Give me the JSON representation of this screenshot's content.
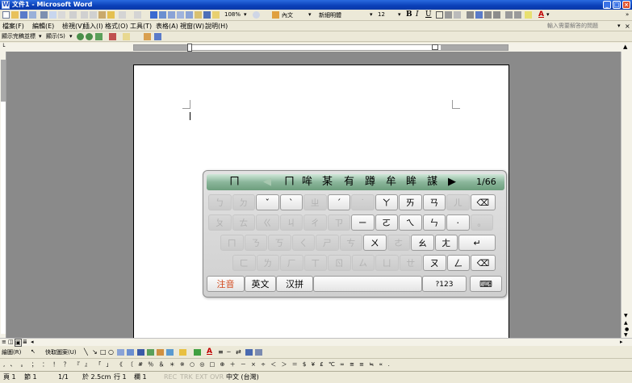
{
  "window": {
    "title": "文件1 - Microsoft Word",
    "minimize_label": "_",
    "maximize_label": "□",
    "close_label": "×"
  },
  "menu": {
    "items": [
      "檔案(F)",
      "編輯(E)",
      "檢視(V)",
      "插入(I)",
      "格式(O)",
      "工具(T)",
      "表格(A)",
      "視窗(W)",
      "說明(H)"
    ],
    "help_placeholder": "輸入需要解答的問題",
    "close_doc": "×"
  },
  "toolbar": {
    "zoom": "108%",
    "style": "內文",
    "font": "新細明體",
    "font_size": "12",
    "bold": "B",
    "italic": "I",
    "underline": "U",
    "font_color_label": "A"
  },
  "review_toolbar": {
    "display_mode": "顯示完稿並標",
    "display_menu": "顯示(S)"
  },
  "draw_toolbar": {
    "draw": "繪圖(R)",
    "autoshapes": "快取圖案(U)"
  },
  "symbol_toolbar": {
    "symbols": ", 、 。 ； ： ！ ？ 『 』 「 」 《 〔 # ％ ＆ ＊ ※ ○ ◎ □ ⊕ ＋ － × ÷ ＜ ＞ ＝ $ ¥ £ ℃ ∞ ≅ ≡ ≒ ∝ ."
  },
  "status": {
    "page": "頁 1",
    "section": "節 1",
    "pages": "1/1",
    "position": "於 2.5cm",
    "line": "行 1",
    "column": "欄 1",
    "modes": [
      "REC",
      "TRK",
      "EXT",
      "OVR"
    ],
    "language": "中文 (台灣)"
  },
  "ime": {
    "candidates": [
      "ㄇ",
      "◀",
      "ㄇ",
      "哞",
      "某",
      "有",
      "蹲",
      "牟",
      "眸",
      "謀",
      "▶",
      "1/66"
    ],
    "rows": [
      [
        {
          "t": "ㄅ",
          "on": false
        },
        {
          "t": "ㄉ",
          "on": false
        },
        {
          "t": "ˇ",
          "on": true
        },
        {
          "t": "ˋ",
          "on": true
        },
        {
          "t": "ㄓ",
          "on": false
        },
        {
          "t": "ˊ",
          "on": true
        },
        {
          "t": "˙",
          "on": false
        },
        {
          "t": "ㄚ",
          "on": true
        },
        {
          "t": "ㄞ",
          "on": true
        },
        {
          "t": "ㄢ",
          "on": true
        },
        {
          "t": "ㄦ",
          "on": false
        },
        {
          "t": "⌫",
          "on": true
        }
      ],
      [
        {
          "t": "ㄆ",
          "on": false
        },
        {
          "t": "ㄊ",
          "on": false
        },
        {
          "t": "ㄍ",
          "on": false
        },
        {
          "t": "ㄐ",
          "on": false
        },
        {
          "t": "ㄔ",
          "on": false
        },
        {
          "t": "ㄗ",
          "on": false
        },
        {
          "t": "ㄧ",
          "on": true
        },
        {
          "t": "ㄛ",
          "on": true
        },
        {
          "t": "ㄟ",
          "on": true
        },
        {
          "t": "ㄣ",
          "on": true
        },
        {
          "t": "·",
          "on": true
        },
        {
          "t": "。",
          "on": false
        }
      ],
      [
        {
          "t": "ㄇ",
          "on": false
        },
        {
          "t": "ㄋ",
          "on": false
        },
        {
          "t": "ㄎ",
          "on": false
        },
        {
          "t": "ㄑ",
          "on": false
        },
        {
          "t": "ㄕ",
          "on": false
        },
        {
          "t": "ㄘ",
          "on": false
        },
        {
          "t": "ㄨ",
          "on": true
        },
        {
          "t": "ㄜ",
          "on": false
        },
        {
          "t": "ㄠ",
          "on": true
        },
        {
          "t": "ㄤ",
          "on": true
        },
        {
          "t": "↵",
          "on": true
        }
      ],
      [
        {
          "t": "ㄈ",
          "on": false
        },
        {
          "t": "ㄌ",
          "on": false
        },
        {
          "t": "ㄏ",
          "on": false
        },
        {
          "t": "ㄒ",
          "on": false
        },
        {
          "t": "ㄖ",
          "on": false
        },
        {
          "t": "ㄙ",
          "on": false
        },
        {
          "t": "ㄩ",
          "on": false
        },
        {
          "t": "ㄝ",
          "on": false
        },
        {
          "t": "ㄡ",
          "on": true
        },
        {
          "t": "ㄥ",
          "on": true
        },
        {
          "t": "⌫",
          "on": true
        }
      ]
    ],
    "bottom": {
      "zhuyin": "注音",
      "english": "英文",
      "pinyin": "汉拼",
      "numbers": "?123",
      "hide": "⌨"
    },
    "colors": {
      "active_mode": "#d24a1e",
      "candidate_bar": "#8ab69a"
    }
  },
  "colors": {
    "title_bar": "#0a3fb8",
    "doc_background": "#8a8a8a",
    "page": "#ffffff"
  }
}
